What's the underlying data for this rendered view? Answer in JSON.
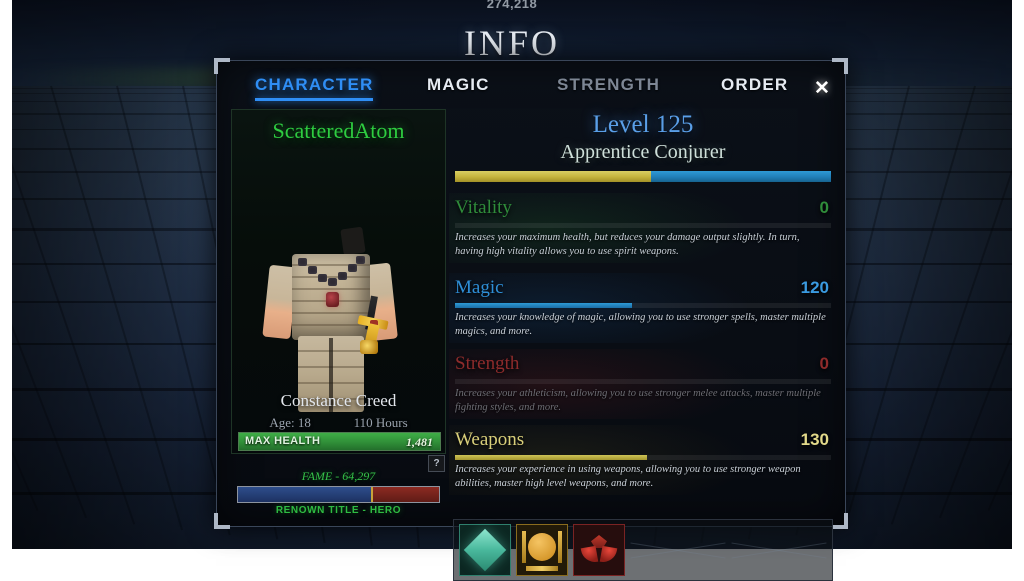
{
  "hud": {
    "top_counter": "274,218"
  },
  "window": {
    "title": "INFO",
    "close_label": "✕"
  },
  "tabs": [
    {
      "label": "CHARACTER",
      "state": "active"
    },
    {
      "label": "MAGIC",
      "state": "bright"
    },
    {
      "label": "STRENGTH",
      "state": "dim"
    },
    {
      "label": "ORDER",
      "state": "bright"
    }
  ],
  "character": {
    "username": "ScatteredAtom",
    "name": "Constance Creed",
    "age": "Age: 18",
    "playtime": "110 Hours",
    "health_label": "MAX HEALTH",
    "health_value": "1,481",
    "health_percent": 100,
    "fame_label": "FAME - 64,297",
    "fame_blue_percent": 66,
    "renown_label": "RENOWN TITLE - HERO",
    "help_label": "?"
  },
  "progression": {
    "level_label": "Level 125",
    "class_label": "Apprentice Conjurer",
    "xp_percent": 52
  },
  "stats": [
    {
      "key": "vitality",
      "name": "Vitality",
      "value": "0",
      "fill_percent": 0,
      "description": "Increases your maximum health, but reduces your damage output slightly. In turn, having high vitality allows you to use spirit weapons."
    },
    {
      "key": "magic",
      "name": "Magic",
      "value": "120",
      "fill_percent": 47,
      "description": "Increases your knowledge of magic, allowing you to use stronger spells, master multiple magics, and more."
    },
    {
      "key": "strength",
      "name": "Strength",
      "value": "0",
      "fill_percent": 0,
      "description": "Increases your athleticism, allowing you to use stronger melee attacks, master multiple fighting styles, and more."
    },
    {
      "key": "weapons",
      "name": "Weapons",
      "value": "130",
      "fill_percent": 51,
      "description": "Increases your experience in using weapons, allowing you to use stronger weapon abilities, master high level weapons, and more."
    }
  ],
  "equipment_slots": [
    {
      "icon": "teal-diamond-icon",
      "filled": true
    },
    {
      "icon": "gold-shield-icon",
      "filled": true
    },
    {
      "icon": "red-mask-icon",
      "filled": true
    },
    {
      "icon": "empty-slot-icon",
      "filled": false
    },
    {
      "icon": "empty-slot-icon",
      "filled": false
    }
  ],
  "colors": {
    "accent_blue": "#2f8ef5",
    "vitality_green": "#2f8c3a",
    "magic_blue": "#2e8ed6",
    "strength_red": "#8e2b2b",
    "weapons_gold": "#d9cf7a",
    "fame_green": "#35c14a",
    "username_green": "#2ecc40"
  }
}
